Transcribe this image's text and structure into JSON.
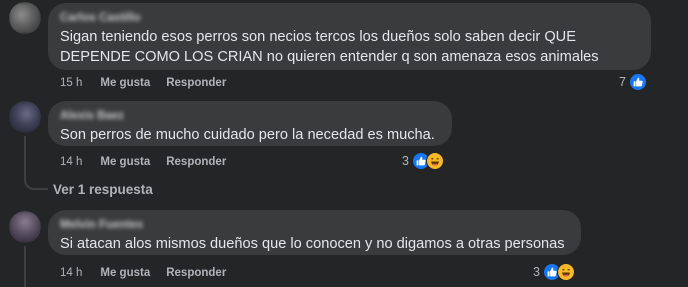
{
  "comments": [
    {
      "author": "Carlos Castillo",
      "text": "Sigan teniendo esos perros son necios tercos los dueños solo saben decir QUE\nDEPENDE COMO LOS CRIAN no quieren entender q son amenaza esos animales",
      "time": "15 h",
      "like_label": "Me gusta",
      "reply_label": "Responder",
      "reaction_count": "7",
      "reactions": [
        "like-icon"
      ]
    },
    {
      "author": "Alexis Baez",
      "text": "Son perros de mucho cuidado pero la necedad es mucha.",
      "time": "14 h",
      "like_label": "Me gusta",
      "reply_label": "Responder",
      "reaction_count": "3",
      "reactions": [
        "like-icon",
        "haha-icon"
      ],
      "view_replies": "Ver 1 respuesta"
    },
    {
      "author": "Melvin Fuentes",
      "text": "Si atacan alos mismos dueños que lo conocen y no digamos a otras personas",
      "time": "14 h",
      "like_label": "Me gusta",
      "reply_label": "Responder",
      "reaction_count": "3",
      "reactions": [
        "like-icon",
        "haha-icon"
      ]
    }
  ],
  "colors": {
    "background": "#242526",
    "bubble": "#3a3b3c",
    "text": "#e4e6eb",
    "muted": "#b0b3b8",
    "like": "#1877f2",
    "haha": "#f7b928"
  }
}
